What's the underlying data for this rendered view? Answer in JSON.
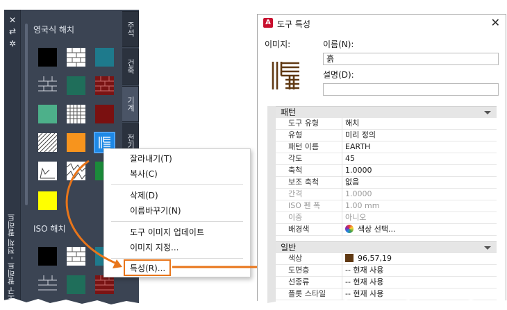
{
  "palette": {
    "title": "도구 팔레트 - 전체 팔레트",
    "controls": {
      "close": "✕",
      "menu": "⇄",
      "settings": "✲"
    },
    "sections": [
      {
        "label": "영국식 해치"
      },
      {
        "label": "ISO 해치"
      }
    ],
    "tabs": [
      "주석",
      "건축",
      "기계",
      "전기"
    ]
  },
  "context_menu": {
    "items": [
      "잘라내기(T)",
      "복사(C)",
      "삭제(D)",
      "이름바꾸기(N)",
      "도구 이미지 업데이트",
      "이미지 지정...",
      "특성(R)..."
    ],
    "highlight_color": "#e8751a"
  },
  "dialog": {
    "title": "도구 특성",
    "app_icon": "A",
    "image_label": "이미지:",
    "name_label": "이름(N):",
    "name_value": "흙",
    "description_label": "설명(D):",
    "description_value": "",
    "sections": {
      "pattern": {
        "header": "패턴",
        "rows": [
          {
            "key": "도구 유형",
            "value": "해치"
          },
          {
            "key": "유형",
            "value": "미리 정의"
          },
          {
            "key": "패턴 이름",
            "value": "EARTH"
          },
          {
            "key": "각도",
            "value": "45"
          },
          {
            "key": "축척",
            "value": "1.0000"
          },
          {
            "key": "보조 축척",
            "value": "없음"
          },
          {
            "key": "간격",
            "value": "1.0000"
          },
          {
            "key": "ISO 펜 폭",
            "value": "1.00 mm"
          },
          {
            "key": "이중",
            "value": "아니오"
          },
          {
            "key": "배경색",
            "value": "색상 선택..."
          }
        ]
      },
      "general": {
        "header": "일반",
        "rows": [
          {
            "key": "색상",
            "value": "96,57,19"
          },
          {
            "key": "도면층",
            "value": "-- 현재 사용"
          },
          {
            "key": "선종류",
            "value": "-- 현재 사용"
          },
          {
            "key": "플롯 스타일",
            "value": "-- 현재 사용"
          }
        ]
      }
    },
    "colors": {
      "accent": "#c8102e",
      "hatch_color": "#603913"
    }
  }
}
